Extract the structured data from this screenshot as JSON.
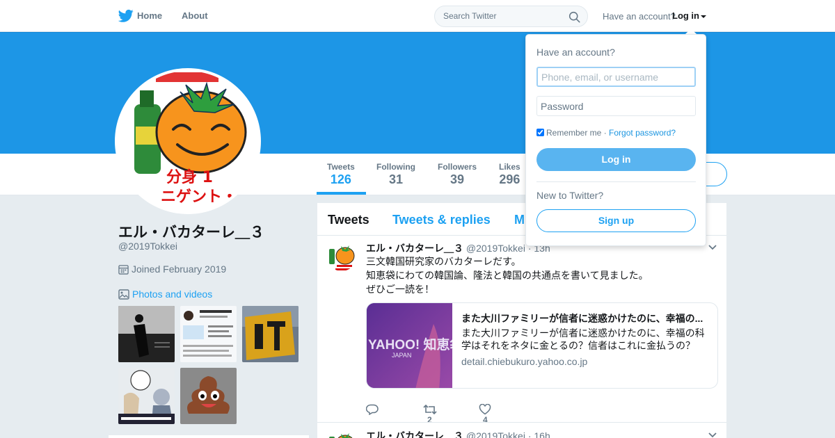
{
  "topnav": {
    "home_label": "Home",
    "about_label": "About",
    "search_placeholder": "Search Twitter",
    "account_prompt": "Have an account?",
    "login_label": "Log in"
  },
  "profile_nav": {
    "stats": [
      {
        "label": "Tweets",
        "value": "126"
      },
      {
        "label": "Following",
        "value": "31"
      },
      {
        "label": "Followers",
        "value": "39"
      },
      {
        "label": "Likes",
        "value": "296"
      }
    ]
  },
  "profile": {
    "name": "エル・バカターレ＿３",
    "handle": "@2019Tokkei",
    "joined": "Joined February 2019",
    "photos_label": "Photos and videos",
    "avatar_text": [
      "分身 1",
      "ニゲント・"
    ]
  },
  "timeline": {
    "tabs": [
      "Tweets",
      "Tweets & replies",
      "M"
    ],
    "tweets": [
      {
        "name": "エル・バカターレ＿３",
        "handle": "@2019Tokkei",
        "time": "· 13h",
        "lines": [
          "三文韓国研究家のバカターレだす。",
          "知恵袋にわての韓国論、隆法と韓国の共通点を書いて見ました。",
          "ぜひご一読を！"
        ],
        "card": {
          "title": "また大川ファミリーが信者に迷惑かけたのに、幸福の...",
          "description": "また大川ファミリーが信者に迷惑かけたのに、幸福の科学はそれをネタに金とるの？信者はこれに金払うの？",
          "domain": "detail.chiebukuro.yahoo.co.jp",
          "image_text": "YAHOO! 知恵袋",
          "image_subtext": "JAPAN"
        },
        "retweets": "2",
        "likes": "4"
      },
      {
        "name": "エル・バカターレ＿３",
        "handle": "@2019Tokkei",
        "time": "· 16h"
      }
    ]
  },
  "login_dropdown": {
    "title": "Have an account?",
    "username_placeholder": "Phone, email, or username",
    "password_placeholder": "Password",
    "remember_label": "Remember me",
    "separator": "·",
    "forgot_label": "Forgot password?",
    "login_button": "Log in",
    "new_prompt": "New to Twitter?",
    "signup_button": "Sign up"
  },
  "colors": {
    "brand": "#1da1f2",
    "banner": "#1d96e6",
    "background": "#e6ecf0"
  }
}
